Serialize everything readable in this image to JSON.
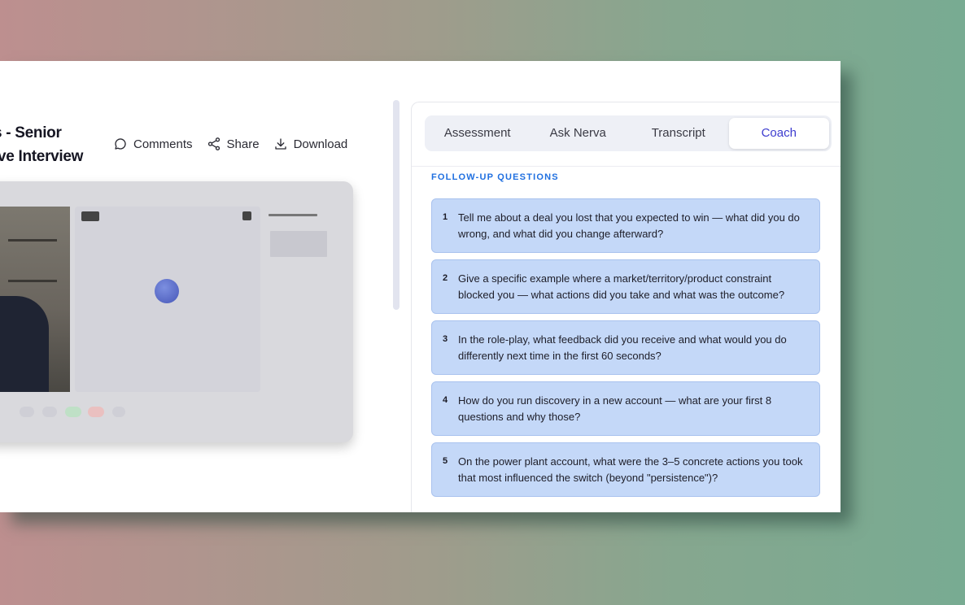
{
  "header": {
    "title_line1": "s - Senior",
    "title_line2": "ive Interview"
  },
  "actions": [
    {
      "label": "Comments",
      "icon": "comment-icon"
    },
    {
      "label": "Share",
      "icon": "share-icon"
    },
    {
      "label": "Download",
      "icon": "download-icon"
    }
  ],
  "tabs": [
    {
      "label": "Assessment",
      "active": false
    },
    {
      "label": "Ask Nerva",
      "active": false
    },
    {
      "label": "Transcript",
      "active": false
    },
    {
      "label": "Coach",
      "active": true
    }
  ],
  "coach": {
    "section_title": "FOLLOW-UP QUESTIONS",
    "questions": [
      {
        "num": "1",
        "text": "Tell me about a deal you lost that you expected to win — what did you do wrong, and what did you change afterward?"
      },
      {
        "num": "2",
        "text": "Give a specific example where a market/territory/product constraint blocked you — what actions did you take and what was the outcome?"
      },
      {
        "num": "3",
        "text": "In the role-play, what feedback did you receive and what would you do differently next time in the first 60 seconds?"
      },
      {
        "num": "4",
        "text": "How do you run discovery in a new account — what are your first 8 questions and why those?"
      },
      {
        "num": "5",
        "text": "On the power plant account, what were the 3–5 concrete actions you took that most influenced the switch (beyond \"persistence\")?"
      }
    ]
  },
  "colors": {
    "accent": "#3d3ccf",
    "section_title": "#1f6fe0",
    "question_bg": "#c4d8f8"
  }
}
